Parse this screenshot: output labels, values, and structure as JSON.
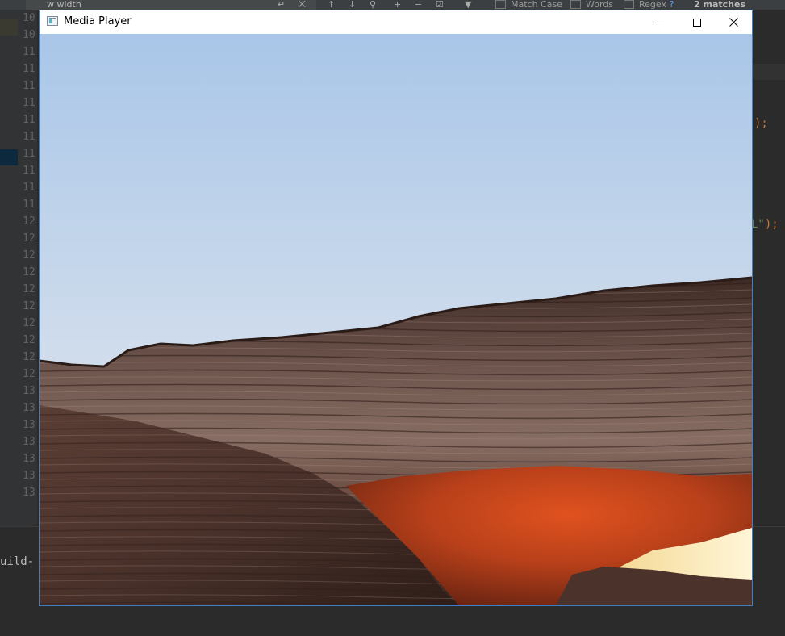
{
  "ide": {
    "search_query": "w width",
    "match_case_label": "Match Case",
    "words_label": "Words",
    "regex_label": "Regex",
    "regex_help": "?",
    "matches_label": "2 matches",
    "line_numbers": [
      "10",
      "10",
      "11",
      "11",
      "11",
      "11",
      "11",
      "11",
      "11",
      "11",
      "11",
      "11",
      "12",
      "12",
      "12",
      "12",
      "12",
      "12",
      "12",
      "12",
      "12",
      "12",
      "13",
      "13",
      "13",
      "13",
      "13",
      "13",
      "13"
    ],
    "code_fragments": {
      "frag1": ");",
      "frag2_str": "L\"",
      "frag2_end": ");"
    },
    "terminal_text": "uild-"
  },
  "player": {
    "title": "Media Player",
    "icon": "media-player-app-icon",
    "buttons": {
      "minimize": "minimize-icon",
      "maximize": "maximize-icon",
      "close": "close-icon"
    },
    "video_frame": "rock-arch-sunrise"
  },
  "colors": {
    "window_border": "#3d7fc4",
    "ide_bg": "#2b2b2b",
    "sky_top": "#a9c6e8",
    "sky_bottom": "#e2e7ee",
    "rock_glow": "#c9441a"
  }
}
